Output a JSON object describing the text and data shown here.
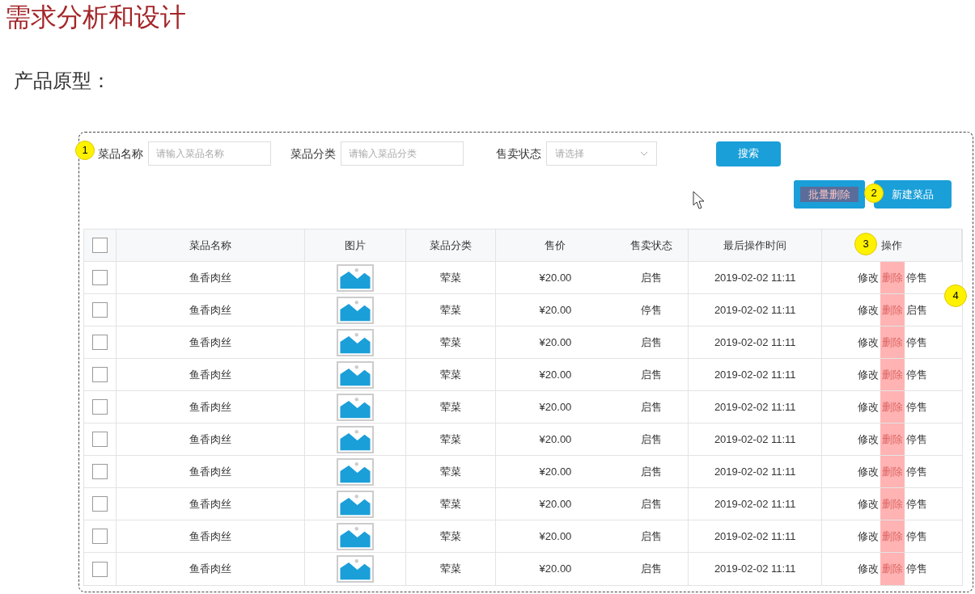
{
  "heading": "需求分析和设计",
  "subheading": "产品原型：",
  "prototype": {
    "filters_badge": "1",
    "filters": [
      {
        "kind": "input",
        "label": "菜品名称",
        "placeholder": "请输入菜品名称"
      },
      {
        "kind": "input",
        "label": "菜品分类",
        "placeholder": "请输入菜品分类"
      },
      {
        "kind": "select",
        "label": "售卖状态",
        "placeholder": "请选择"
      }
    ],
    "search_button": "搜索",
    "actions": [
      {
        "label": "批量删除",
        "highlighted": true
      },
      {
        "label": "新建菜品",
        "highlighted": false,
        "badge": "2"
      }
    ],
    "table": {
      "header_checked": false,
      "columns": [
        {
          "label": "菜品名称"
        },
        {
          "label": "图片"
        },
        {
          "label": "菜品分类"
        },
        {
          "label": "售价"
        },
        {
          "label": "售卖状态"
        },
        {
          "label": "最后操作时间"
        },
        {
          "label": "操作",
          "badge": "3"
        }
      ],
      "rows": [
        {
          "checked": false,
          "name": "鱼香肉丝",
          "category": "荤菜",
          "price": "¥20.00",
          "status": "启售",
          "time": "2019-02-02 11:11",
          "actions": [
            {
              "label": "修改",
              "highlighted": false
            },
            {
              "label": "删除",
              "highlighted": true
            },
            {
              "label": "停售",
              "highlighted": false
            }
          ]
        },
        {
          "checked": false,
          "name": "鱼香肉丝",
          "category": "荤菜",
          "price": "¥20.00",
          "status": "停售",
          "time": "2019-02-02 11:11",
          "badge": "4",
          "actions": [
            {
              "label": "修改",
              "highlighted": false
            },
            {
              "label": "删除",
              "highlighted": true
            },
            {
              "label": "启售",
              "highlighted": false
            }
          ]
        },
        {
          "checked": false,
          "name": "鱼香肉丝",
          "category": "荤菜",
          "price": "¥20.00",
          "status": "启售",
          "time": "2019-02-02 11:11",
          "actions": [
            {
              "label": "修改",
              "highlighted": false
            },
            {
              "label": "删除",
              "highlighted": true
            },
            {
              "label": "停售",
              "highlighted": false
            }
          ]
        },
        {
          "checked": false,
          "name": "鱼香肉丝",
          "category": "荤菜",
          "price": "¥20.00",
          "status": "启售",
          "time": "2019-02-02 11:11",
          "actions": [
            {
              "label": "修改",
              "highlighted": false
            },
            {
              "label": "删除",
              "highlighted": true
            },
            {
              "label": "停售",
              "highlighted": false
            }
          ]
        },
        {
          "checked": false,
          "name": "鱼香肉丝",
          "category": "荤菜",
          "price": "¥20.00",
          "status": "启售",
          "time": "2019-02-02 11:11",
          "actions": [
            {
              "label": "修改",
              "highlighted": false
            },
            {
              "label": "删除",
              "highlighted": true
            },
            {
              "label": "停售",
              "highlighted": false
            }
          ]
        },
        {
          "checked": false,
          "name": "鱼香肉丝",
          "category": "荤菜",
          "price": "¥20.00",
          "status": "启售",
          "time": "2019-02-02 11:11",
          "actions": [
            {
              "label": "修改",
              "highlighted": false
            },
            {
              "label": "删除",
              "highlighted": true
            },
            {
              "label": "停售",
              "highlighted": false
            }
          ]
        },
        {
          "checked": false,
          "name": "鱼香肉丝",
          "category": "荤菜",
          "price": "¥20.00",
          "status": "启售",
          "time": "2019-02-02 11:11",
          "actions": [
            {
              "label": "修改",
              "highlighted": false
            },
            {
              "label": "删除",
              "highlighted": true
            },
            {
              "label": "停售",
              "highlighted": false
            }
          ]
        },
        {
          "checked": false,
          "name": "鱼香肉丝",
          "category": "荤菜",
          "price": "¥20.00",
          "status": "启售",
          "time": "2019-02-02 11:11",
          "actions": [
            {
              "label": "修改",
              "highlighted": false
            },
            {
              "label": "删除",
              "highlighted": true
            },
            {
              "label": "停售",
              "highlighted": false
            }
          ]
        },
        {
          "checked": false,
          "name": "鱼香肉丝",
          "category": "荤菜",
          "price": "¥20.00",
          "status": "启售",
          "time": "2019-02-02 11:11",
          "actions": [
            {
              "label": "修改",
              "highlighted": false
            },
            {
              "label": "删除",
              "highlighted": true
            },
            {
              "label": "停售",
              "highlighted": false
            }
          ]
        },
        {
          "checked": false,
          "name": "鱼香肉丝",
          "category": "荤菜",
          "price": "¥20.00",
          "status": "启售",
          "time": "2019-02-02 11:11",
          "actions": [
            {
              "label": "修改",
              "highlighted": false
            },
            {
              "label": "删除",
              "highlighted": true
            },
            {
              "label": "停售",
              "highlighted": false
            }
          ]
        }
      ]
    }
  }
}
